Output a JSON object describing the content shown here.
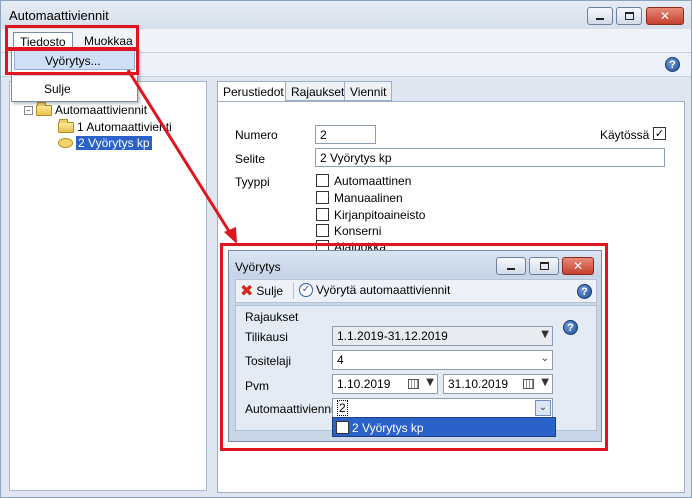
{
  "window": {
    "title": "Automaattiviennit"
  },
  "menubar": {
    "file": "Tiedosto",
    "edit": "Muokkaa"
  },
  "file_menu": {
    "items": [
      "Vyörytys...",
      "Sulje"
    ]
  },
  "tree": {
    "root": "Automaattiviennit",
    "children": [
      "1 Automaattivienti",
      "2 Vyörytys kp"
    ]
  },
  "tabs": [
    "Perustiedot",
    "Rajaukset",
    "Viennit"
  ],
  "form": {
    "numero_label": "Numero",
    "numero_value": "2",
    "kaytossa_label": "Käytössä",
    "selite_label": "Selite",
    "selite_value": "2 Vyörytys kp",
    "tyyppi_label": "Tyyppi",
    "tyyppi_options": [
      "Automaattinen",
      "Manuaalinen",
      "Kirjanpitoaineisto",
      "Konserni",
      "Alaluokka"
    ]
  },
  "dialog": {
    "title": "Vyörytys",
    "close_label": "Sulje",
    "run_label": "Vyörytä automaattiviennit",
    "group_label": "Rajaukset",
    "tilikausi_label": "Tilikausi",
    "tilikausi_value": "1.1.2019-31.12.2019",
    "tositelaji_label": "Tositelaji",
    "tositelaji_value": "4",
    "pvm_label": "Pvm",
    "pvm_from": "1.10.2019",
    "pvm_to": "31.10.2019",
    "automaattiviennit_label": "Automaattiviennit",
    "automaattiviennit_value": "2",
    "dropdown_option": "2 Vyörytys kp"
  },
  "annotation_color": "#e0141e"
}
